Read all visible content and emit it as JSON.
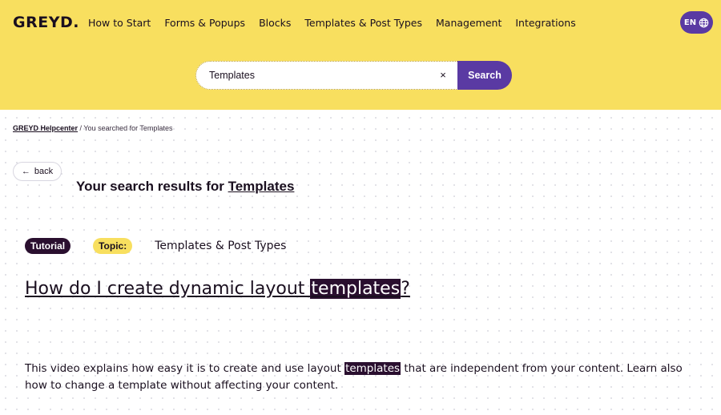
{
  "header": {
    "logo": "GREYD.",
    "nav": [
      "How to Start",
      "Forms & Popups",
      "Blocks",
      "Templates & Post Types",
      "Management",
      "Integrations"
    ],
    "language": "EN",
    "colors": {
      "background": "#f8df5f",
      "accent": "#5a3aa3"
    }
  },
  "search": {
    "value": "Templates",
    "clear_label": "×",
    "button_label": "Search"
  },
  "breadcrumb": {
    "home": "GREYD Helpcenter",
    "separator": " / ",
    "current": "You searched for Templates"
  },
  "back_label": "back",
  "results": {
    "heading_prefix": "Your search results for ",
    "term": "Templates"
  },
  "result": {
    "type_tag": "Tutorial",
    "topic_label": "Topic:",
    "topic_name": "Templates & Post Types",
    "title_before": "How do I create dynamic layout ",
    "title_highlight": "templates",
    "title_after": "?",
    "desc_before": "This video explains how easy it is to create and use layout ",
    "desc_highlight": "templates",
    "desc_after": " that are independent from your content. Learn also how to change a template without affecting your content."
  }
}
